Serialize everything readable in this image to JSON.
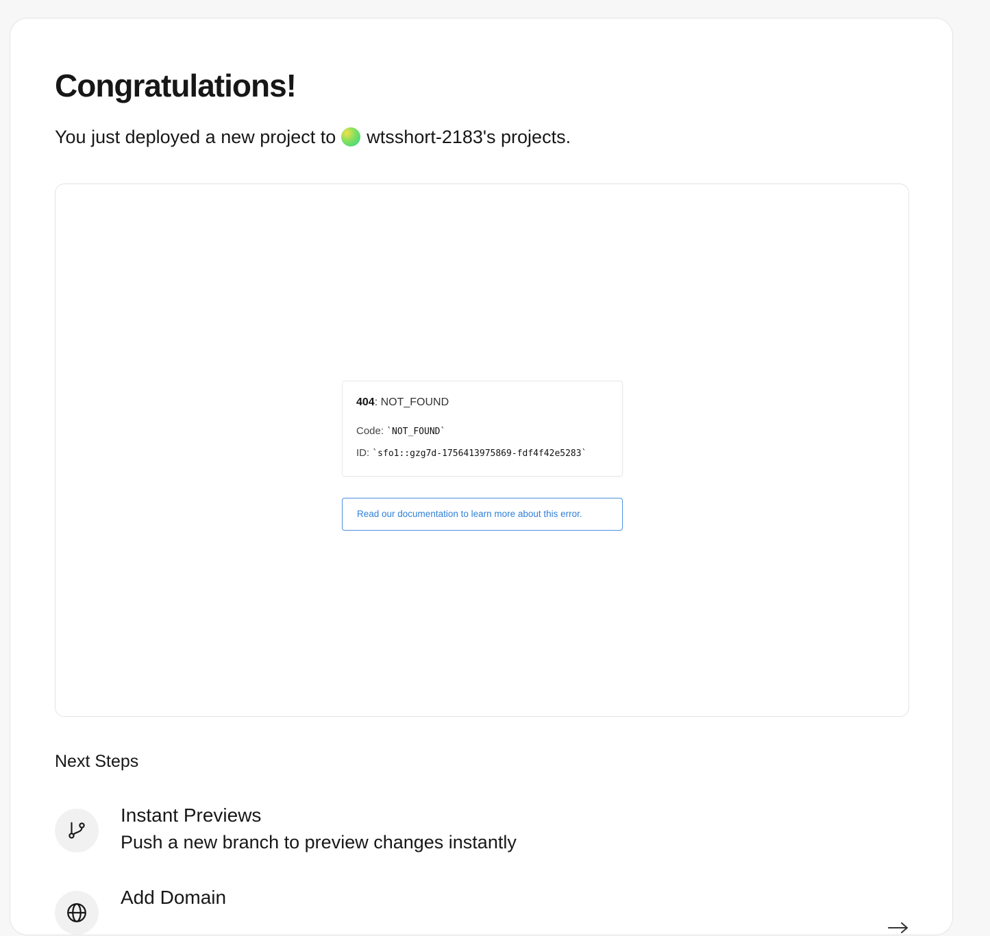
{
  "header": {
    "title": "Congratulations!",
    "subtitle_prefix": "You just deployed a new project to",
    "team_name": "wtsshort-2183's projects."
  },
  "preview": {
    "error_code": "404",
    "error_name": ": NOT_FOUND",
    "code_label": "Code: ",
    "code_value": "`NOT_FOUND`",
    "id_label": "ID: ",
    "id_value": "`sfo1::gzg7d-1756413975869-fdf4f42e5283`",
    "doc_link": "Read our documentation to learn more about this error."
  },
  "next_steps": {
    "heading": "Next Steps",
    "items": [
      {
        "icon": "git-branch-icon",
        "title": "Instant Previews",
        "description": "Push a new branch to preview changes instantly"
      },
      {
        "icon": "globe-icon",
        "title": "Add Domain",
        "description": ""
      }
    ]
  },
  "colors": {
    "link": "#2f7fd8",
    "link_border": "#4a90e2",
    "background": "#f7f7f7"
  }
}
